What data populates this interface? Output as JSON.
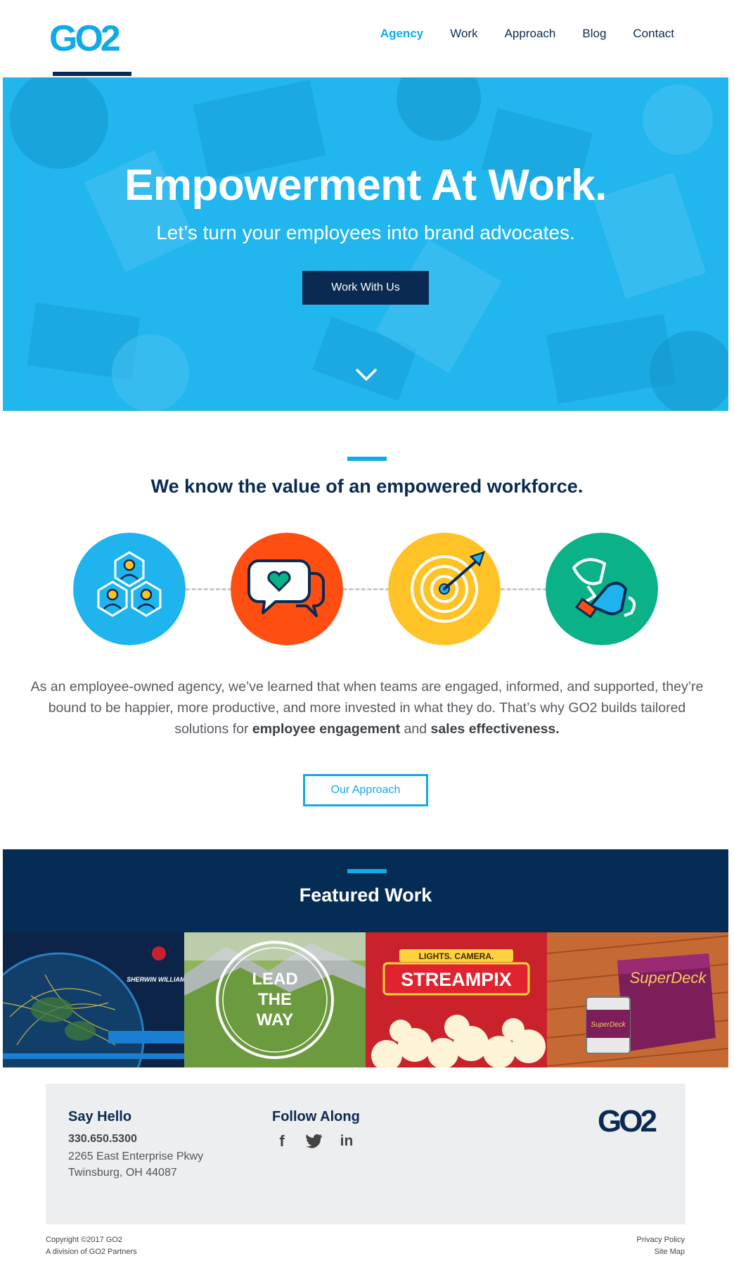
{
  "brand": {
    "logo_text": "GO2",
    "footer_logo_text": "GO2",
    "primary": "#10aae8",
    "navy": "#0a2a52"
  },
  "nav": {
    "items": [
      {
        "label": "Agency",
        "active": true
      },
      {
        "label": "Work",
        "active": false
      },
      {
        "label": "Approach",
        "active": false
      },
      {
        "label": "Blog",
        "active": false
      },
      {
        "label": "Contact",
        "active": false
      }
    ]
  },
  "hero": {
    "title": "Empowerment At Work.",
    "subtitle": "Let’s turn your employees into brand advocates.",
    "cta_label": "Work With Us",
    "scroll_icon": "chevron-down-icon"
  },
  "value": {
    "title": "We know the value of an empowered workforce.",
    "icons": [
      {
        "name": "team-hexagon-icon",
        "color": "#1fb4ee"
      },
      {
        "name": "chat-heart-icon",
        "color": "#ff4e12"
      },
      {
        "name": "target-arrow-icon",
        "color": "#ffc328"
      },
      {
        "name": "trophy-icon",
        "color": "#0bb288"
      }
    ],
    "body_part1": "As an employee-owned agency, we’ve learned that when teams are engaged, informed, and supported, they’re bound to be happier, more productive, and more invested in what they do. That’s why GO2 builds tailored solutions for ",
    "body_bold1": "employee engagement",
    "body_part2": " and ",
    "body_bold2": "sales effectiveness.",
    "cta_label": "Our Approach"
  },
  "featured": {
    "title": "Featured Work",
    "tiles": [
      {
        "name": "sherwin-williams-globe",
        "caption": "SHERWIN WILLIAMS."
      },
      {
        "name": "lead-the-way",
        "line1": "LEAD",
        "line2": "THE",
        "line3": "WAY"
      },
      {
        "name": "streampix",
        "top": "LIGHTS. CAMERA.",
        "main": "STREAMPIX"
      },
      {
        "name": "superdeck",
        "label": "SuperDeck",
        "can_label": "SuperDeck"
      }
    ]
  },
  "footer": {
    "say_hello": "Say Hello",
    "phone": "330.650.5300",
    "address1": "2265 East Enterprise Pkwy",
    "address2": "Twinsburg, OH 44087",
    "follow": "Follow Along",
    "social": [
      {
        "name": "facebook-icon",
        "glyph": "f"
      },
      {
        "name": "twitter-icon",
        "glyph": ""
      },
      {
        "name": "linkedin-icon",
        "glyph": "in"
      }
    ],
    "copyright": "Copyright ©2017 GO2",
    "division": "A division of GO2 Partners",
    "privacy": "Privacy Policy",
    "sitemap": "Site Map"
  }
}
